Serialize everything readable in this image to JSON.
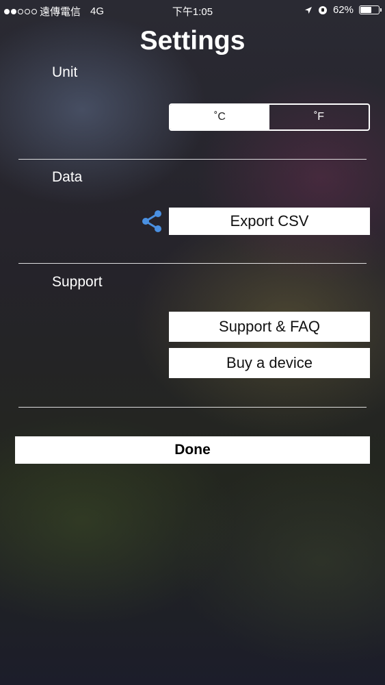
{
  "status_bar": {
    "carrier": "遠傳電信",
    "network": "4G",
    "time": "下午1:05",
    "battery": "62%",
    "battery_level": 0.62,
    "signal_bars_filled": 2,
    "signal_bars_total": 5
  },
  "header": {
    "title": "Settings"
  },
  "unit_section": {
    "label": "Unit",
    "options": [
      "˚C",
      "˚F"
    ],
    "selected": "˚C"
  },
  "data_section": {
    "label": "Data",
    "share_icon": "share-icon",
    "export_label": "Export CSV",
    "accent_color": "#4a90e2"
  },
  "support_section": {
    "label": "Support",
    "faq_label": "Support & FAQ",
    "buy_label": "Buy a device"
  },
  "done_label": "Done"
}
